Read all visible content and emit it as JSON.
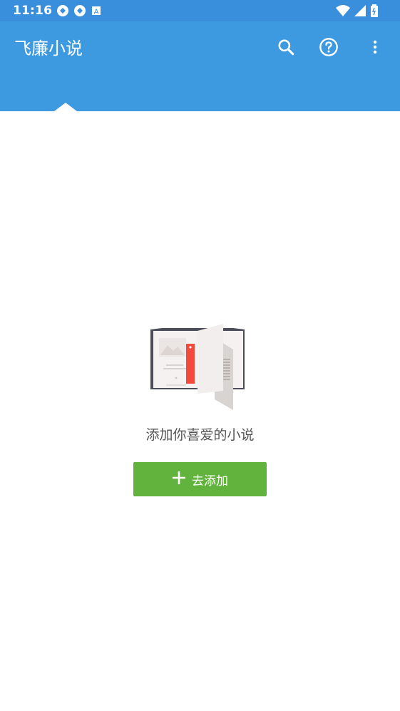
{
  "status_bar": {
    "time": "11:16",
    "icons": [
      "sync-icon",
      "sync-icon",
      "a-badge-icon",
      "wifi-icon",
      "signal-icon",
      "battery-icon"
    ]
  },
  "app_bar": {
    "title": "飞廉小说",
    "actions": [
      "search-icon",
      "help-icon",
      "more-vert-icon"
    ],
    "color": "#3d99e0"
  },
  "empty_state": {
    "message": "添加你喜爱的小说",
    "button_label": "去添加",
    "button_icon": "plus-icon",
    "button_color": "#62b33e"
  }
}
